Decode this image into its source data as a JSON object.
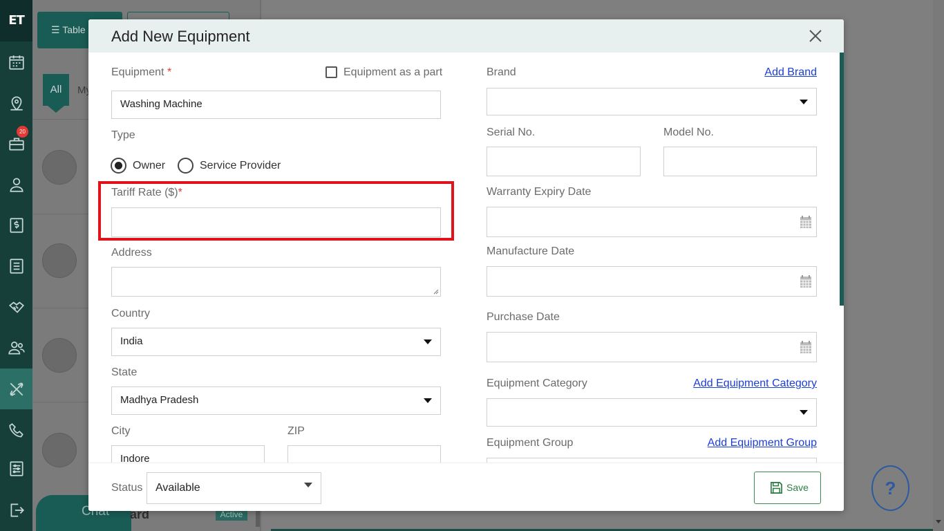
{
  "app": {
    "logo": "ET"
  },
  "nav": {
    "badge_count": "20",
    "items": [
      "calendar-icon",
      "map-pin-icon",
      "briefcase-icon",
      "user-icon",
      "dollar-icon",
      "list-icon",
      "handshake-icon",
      "users-icon",
      "tools-icon",
      "phone-icon",
      "settings-list-icon",
      "logout-icon"
    ]
  },
  "background": {
    "table_button": "Table",
    "tab_all": "All",
    "tab_my": "My",
    "chat_label": "Chat",
    "row_title_fragment": "ard",
    "row_status": "Active"
  },
  "modal": {
    "title": "Add New Equipment",
    "left": {
      "equipment_label": "Equipment",
      "required_mark": "*",
      "equipment_as_part_label": "Equipment as a part",
      "equipment_value": "Washing Machine",
      "type_label": "Type",
      "type_options": [
        "Owner",
        "Service Provider"
      ],
      "type_selected": "Owner",
      "tariff_label": "Tariff Rate ($)",
      "tariff_value": "",
      "address_label": "Address",
      "address_value": "",
      "country_label": "Country",
      "country_value": "India",
      "state_label": "State",
      "state_value": "Madhya Pradesh",
      "city_label": "City",
      "city_value": "Indore",
      "zip_label": "ZIP",
      "zip_value": ""
    },
    "right": {
      "brand_label": "Brand",
      "add_brand_link": "Add Brand",
      "brand_value": "",
      "serial_label": "Serial No.",
      "serial_value": "",
      "model_label": "Model No.",
      "model_value": "",
      "warranty_label": "Warranty Expiry Date",
      "manufacture_label": "Manufacture Date",
      "purchase_label": "Purchase Date",
      "category_label": "Equipment Category",
      "add_category_link": "Add Equipment Category",
      "group_label": "Equipment Group",
      "add_group_link": "Add Equipment Group"
    },
    "footer": {
      "status_label": "Status",
      "status_value": "Available",
      "save_label": "Save"
    }
  },
  "help_label": "?",
  "colors": {
    "brand_dark": "#173f3a",
    "brand": "#195c55",
    "required": "#e53935",
    "highlight": "#e0131b",
    "link": "#1a3fd6",
    "save": "#2b7d44"
  }
}
